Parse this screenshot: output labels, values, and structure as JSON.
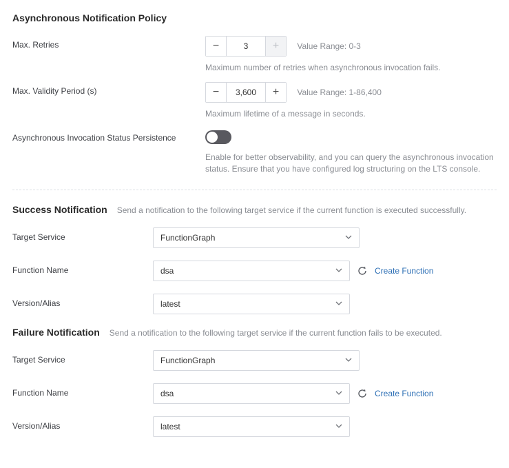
{
  "async_policy": {
    "title": "Asynchronous Notification Policy",
    "max_retries": {
      "label": "Max. Retries",
      "value": "3",
      "range_hint": "Value Range: 0-3",
      "desc": "Maximum number of retries when asynchronous invocation fails."
    },
    "max_validity": {
      "label": "Max. Validity Period (s)",
      "value": "3,600",
      "range_hint": "Value Range: 1-86,400",
      "desc": "Maximum lifetime of a message in seconds."
    },
    "status_persist": {
      "label": "Asynchronous Invocation Status Persistence",
      "on": false,
      "desc": "Enable for better observability, and you can query the asynchronous invocation status. Ensure that you have configured log structuring on the LTS console."
    }
  },
  "success": {
    "title": "Success Notification",
    "desc": "Send a notification to the following target service if the current function is executed successfully.",
    "target_service": {
      "label": "Target Service",
      "value": "FunctionGraph"
    },
    "function_name": {
      "label": "Function Name",
      "value": "dsa",
      "create_link": "Create Function"
    },
    "version_alias": {
      "label": "Version/Alias",
      "value": "latest"
    }
  },
  "failure": {
    "title": "Failure Notification",
    "desc": "Send a notification to the following target service if the current function fails to be executed.",
    "target_service": {
      "label": "Target Service",
      "value": "FunctionGraph"
    },
    "function_name": {
      "label": "Function Name",
      "value": "dsa",
      "create_link": "Create Function"
    },
    "version_alias": {
      "label": "Version/Alias",
      "value": "latest"
    }
  }
}
